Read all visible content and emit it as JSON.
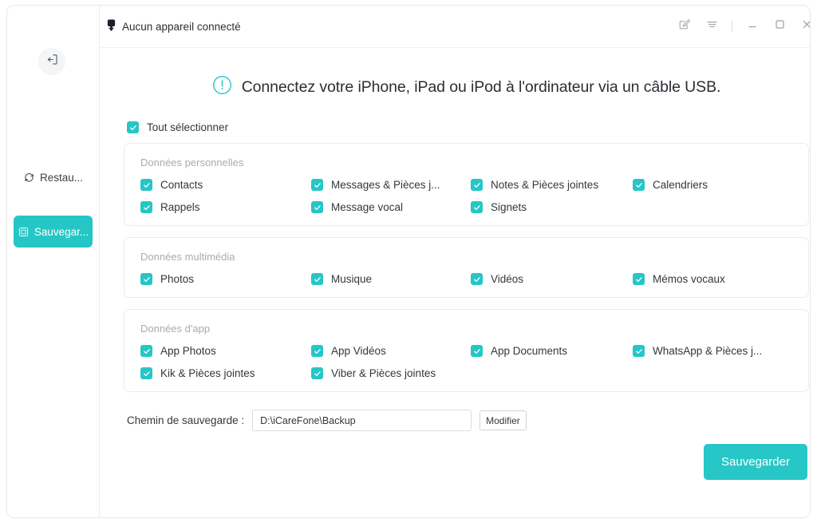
{
  "window": {
    "device_status": "Aucun appareil connecté",
    "device_icon": "usb-connector-icon"
  },
  "titlebar": {
    "feedback_icon": "edit-feedback-icon",
    "menu_icon": "hamburger-menu-icon",
    "minimize_icon": "minimize-icon",
    "maximize_icon": "maximize-icon",
    "close_icon": "close-icon"
  },
  "sidebar": {
    "collapse_icon": "collapse-panel-icon",
    "items": [
      {
        "label": "Restau...",
        "icon": "restore-refresh-icon",
        "active": false
      },
      {
        "label": "Sauvegar...",
        "icon": "backup-square-icon",
        "active": true
      }
    ]
  },
  "banner": {
    "icon": "alert-exclamation-icon",
    "text": "Connectez votre iPhone, iPad ou iPod à l'ordinateur via un câble USB."
  },
  "select_all": {
    "label": "Tout sélectionner",
    "checked": true
  },
  "sections": [
    {
      "title": "Données personnelles",
      "rows": [
        [
          {
            "label": "Contacts",
            "checked": true
          },
          {
            "label": "Messages & Pièces j...",
            "checked": true
          },
          {
            "label": "Notes & Pièces jointes",
            "checked": true
          },
          {
            "label": "Calendriers",
            "checked": true
          }
        ],
        [
          {
            "label": "Rappels",
            "checked": true
          },
          {
            "label": "Message vocal",
            "checked": true
          },
          {
            "label": "Signets",
            "checked": true
          }
        ]
      ]
    },
    {
      "title": "Données multimédia",
      "rows": [
        [
          {
            "label": "Photos",
            "checked": true
          },
          {
            "label": "Musique",
            "checked": true
          },
          {
            "label": "Vidéos",
            "checked": true
          },
          {
            "label": "Mémos vocaux",
            "checked": true
          }
        ]
      ]
    },
    {
      "title": "Données d'app",
      "rows": [
        [
          {
            "label": "App Photos",
            "checked": true
          },
          {
            "label": "App Vidéos",
            "checked": true
          },
          {
            "label": "App Documents",
            "checked": true
          },
          {
            "label": "WhatsApp & Pièces j...",
            "checked": true
          }
        ],
        [
          {
            "label": "Kik & Pièces jointes",
            "checked": true
          },
          {
            "label": "Viber & Pièces jointes",
            "checked": true
          }
        ]
      ]
    }
  ],
  "backup_path": {
    "label": "Chemin de sauvegarde :",
    "value": "D:\\iCareFone\\Backup",
    "placeholder": "",
    "modify_label": "Modifier"
  },
  "primary_action": {
    "label": "Sauvegarder"
  },
  "colors": {
    "accent": "#26c6c6",
    "text": "#33373c",
    "muted": "#a7acb1",
    "border": "#ececee"
  }
}
